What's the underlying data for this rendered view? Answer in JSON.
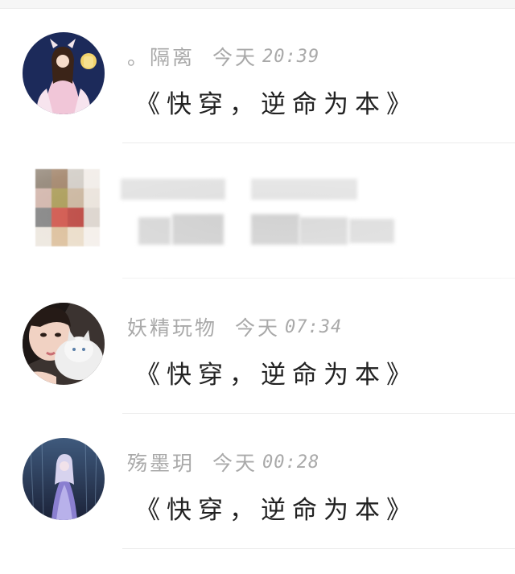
{
  "comments": [
    {
      "username": "。隔离",
      "date_label": "今天",
      "time": "20:39",
      "text": "《快穿，逆命为本》"
    },
    {
      "username": "妖精玩物",
      "date_label": "今天",
      "time": "07:34",
      "text": "《快穿，逆命为本》"
    },
    {
      "username": "殇墨玥",
      "date_label": "今天",
      "time": "00:28",
      "text": "《快穿，逆命为本》"
    }
  ],
  "pixelated_comment": {
    "avatar_tiles": [
      "#7a6a58",
      "#8e6a4a",
      "#c9c3bb",
      "#efe9e4",
      "#c9a79b",
      "#9b8a3a",
      "#c1a98e",
      "#e7dfd6",
      "#6e6e6e",
      "#c83a2e",
      "#b22c25",
      "#d7cfc7",
      "#e9e2d8",
      "#d6b48a",
      "#e7d7c0",
      "#f3ede7"
    ]
  }
}
